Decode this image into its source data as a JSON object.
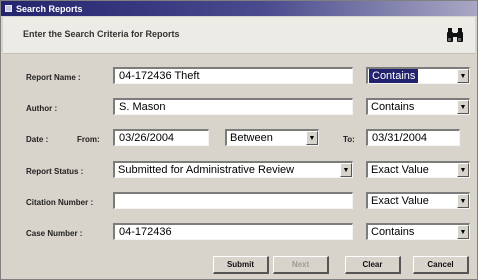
{
  "window": {
    "title": "Search Reports"
  },
  "header": {
    "instruction": "Enter the Search Criteria for Reports",
    "icon": "binoculars-icon"
  },
  "form": {
    "report_name": {
      "label": "Report Name :",
      "value": "04-172436 Theft",
      "operator": "Contains"
    },
    "author": {
      "label": "Author :",
      "value": "S. Mason",
      "operator": "Contains"
    },
    "date": {
      "label": "Date :",
      "from_label": "From:",
      "from_value": "03/26/2004",
      "operator": "Between",
      "to_label": "To:",
      "to_value": "03/31/2004"
    },
    "report_status": {
      "label": "Report Status :",
      "value": "Submitted for Administrative Review",
      "operator": "Exact Value"
    },
    "citation_number": {
      "label": "Citation Number :",
      "value": "",
      "operator": "Exact Value"
    },
    "case_number": {
      "label": "Case Number :",
      "value": "04-172436",
      "operator": "Contains"
    }
  },
  "buttons": {
    "submit": "Submit",
    "next": "Next",
    "clear": "Clear",
    "cancel": "Cancel"
  },
  "colors": {
    "title_bar": "#24246e",
    "selection": "#22226e",
    "face": "#d8d4cc"
  }
}
